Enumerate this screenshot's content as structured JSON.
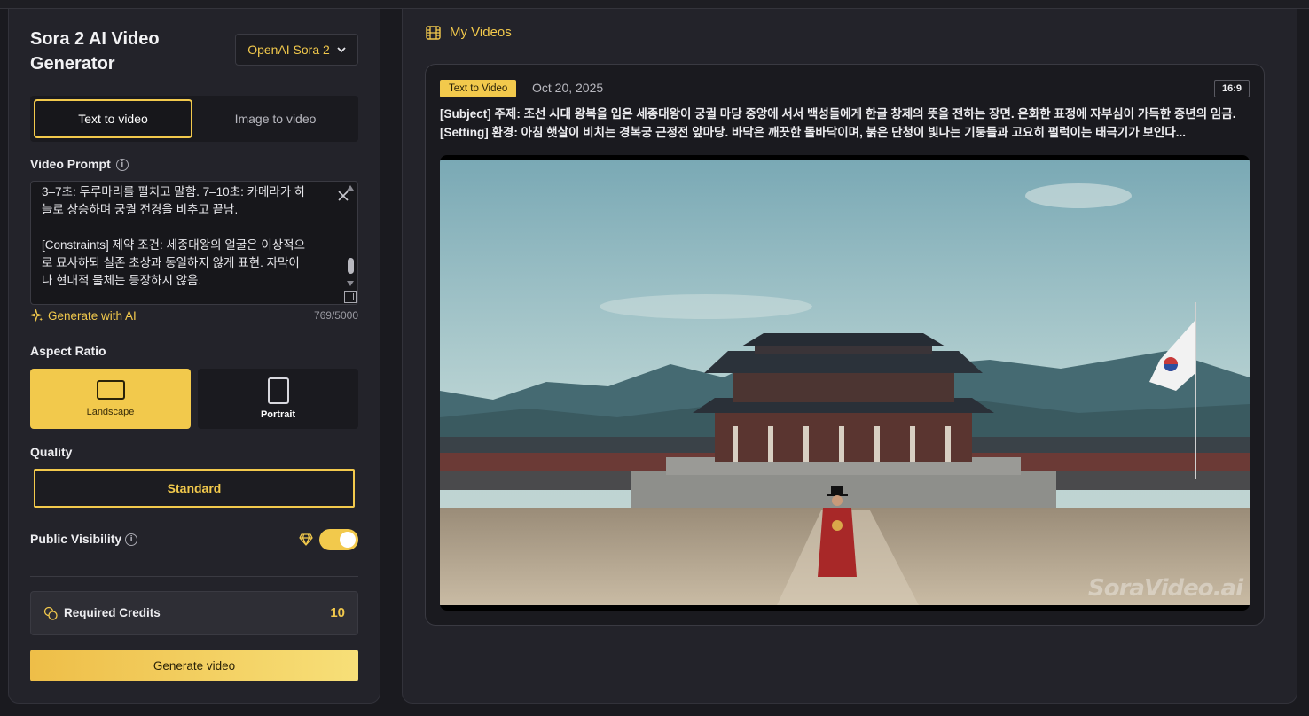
{
  "app": {
    "title": "Sora 2 AI Video Generator",
    "model_selector": "OpenAI Sora 2"
  },
  "tabs": [
    {
      "label": "Text to video",
      "active": true
    },
    {
      "label": "Image to video",
      "active": false
    }
  ],
  "prompt": {
    "label": "Video Prompt",
    "text": "3–7초: 두루마리를 펼치고 말함. 7–10초: 카메라가 하늘로 상승하며 궁궐 전경을 비추고 끝남.\n\n[Constraints] 제약 조건: 세종대왕의 얼굴은 이상적으로 묘사하되 실존 초상과 동일하지 않게 표현. 자막이나 현대적 물체는 등장하지 않음.",
    "generate_with_ai": "Generate with AI",
    "char_count": "769/5000"
  },
  "aspect_ratio": {
    "label": "Aspect Ratio",
    "options": [
      {
        "label": "Landscape",
        "selected": true
      },
      {
        "label": "Portrait",
        "selected": false
      }
    ]
  },
  "quality": {
    "label": "Quality",
    "selected": "Standard"
  },
  "visibility": {
    "label": "Public Visibility",
    "enabled": true
  },
  "credits": {
    "label": "Required Credits",
    "value": "10"
  },
  "generate_button": "Generate video",
  "my_videos": {
    "title": "My Videos",
    "items": [
      {
        "type_badge": "Text to Video",
        "date": "Oct 20, 2025",
        "ratio": "16:9",
        "description": "[Subject] 주제: 조선 시대 왕복을 입은 세종대왕이 궁궐 마당 중앙에 서서 백성들에게 한글 창제의 뜻을 전하는 장면. 온화한 표정에 자부심이 가득한 중년의 임금. [Setting] 환경: 아침 햇살이 비치는 경복궁 근정전 앞마당. 바닥은 깨끗한 돌바닥이며, 붉은 단청이 빛나는 기둥들과 고요히 펄럭이는 태극기가 보인다...",
        "watermark": "SoraVideo.ai"
      }
    ]
  },
  "colors": {
    "accent": "#f2c94c",
    "panel": "#23232a",
    "background": "#1a1a1f"
  }
}
